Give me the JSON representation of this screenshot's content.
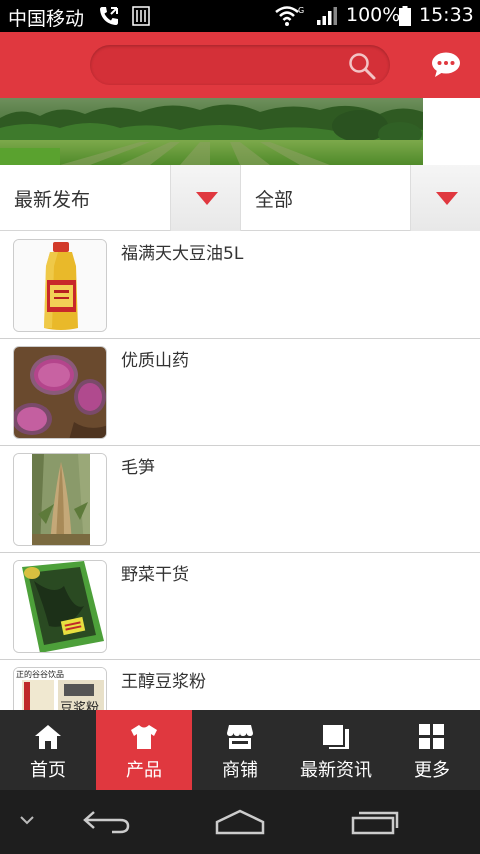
{
  "status_bar": {
    "carrier": "中国移动",
    "network_type": "G",
    "battery": "100%",
    "time": "15:33"
  },
  "header": {
    "search_placeholder": ""
  },
  "filters": {
    "sort": {
      "label": "最新发布"
    },
    "category": {
      "label": "全部"
    }
  },
  "products": [
    {
      "name": "福满天大豆油5L"
    },
    {
      "name": "优质山药"
    },
    {
      "name": "毛笋"
    },
    {
      "name": "野菜干货"
    },
    {
      "name": "王醇豆浆粉"
    }
  ],
  "thumb_text": {
    "bean_powder_brand": "豆浆粉",
    "bean_powder_top": "正的谷谷饮品"
  },
  "bottom_nav": [
    {
      "label": "首页",
      "icon": "home-icon",
      "active": false
    },
    {
      "label": "产品",
      "icon": "shirt-icon",
      "active": true
    },
    {
      "label": "商铺",
      "icon": "shop-icon",
      "active": false
    },
    {
      "label": "最新资讯",
      "icon": "news-icon",
      "active": false
    },
    {
      "label": "更多",
      "icon": "grid-icon",
      "active": false
    }
  ],
  "colors": {
    "brand_red": "#e0383f",
    "nav_dark": "#2b2b2b"
  }
}
